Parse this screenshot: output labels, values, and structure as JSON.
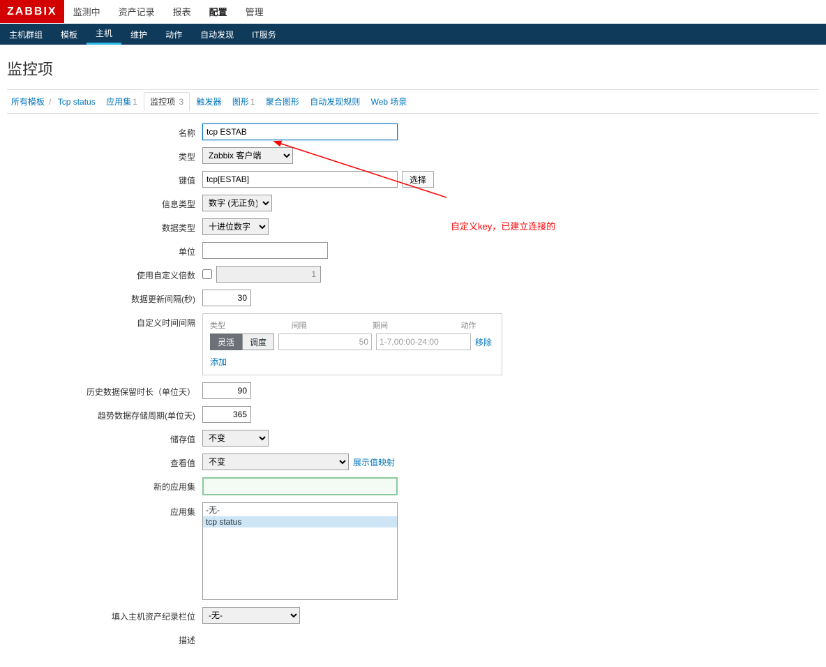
{
  "logo": "ZABBIX",
  "topmenu": {
    "monitoring": "监测中",
    "inventory": "资产记录",
    "reports": "报表",
    "config": "配置",
    "admin": "管理"
  },
  "submenu": {
    "hostgroups": "主机群组",
    "templates": "模板",
    "hosts": "主机",
    "maintenance": "维护",
    "actions": "动作",
    "discovery": "自动发现",
    "itservices": "IT服务"
  },
  "page_title": "监控项",
  "breadcrumb": {
    "all_templates": "所有模板",
    "tcp_status": "Tcp status",
    "apps": "应用集",
    "apps_count": "1",
    "items": "监控项",
    "items_count": "3",
    "triggers": "触发器",
    "graphs": "图形",
    "graphs_count": "1",
    "screens": "聚合图形",
    "drules": "自动发现规则",
    "web": "Web 场景"
  },
  "labels": {
    "name": "名称",
    "type": "类型",
    "key": "键值",
    "info_type": "信息类型",
    "data_type": "数据类型",
    "units": "单位",
    "custom_mult": "使用自定义倍数",
    "update_interval": "数据更新间隔(秒)",
    "custom_intervals": "自定义时间间隔",
    "history": "历史数据保留时长（单位天）",
    "trends": "趋势数据存储周期(单位天)",
    "store": "储存值",
    "show_value": "查看值",
    "new_app": "新的应用集",
    "apps": "应用集",
    "host_inv": "填入主机资产纪录栏位",
    "desc": "描述"
  },
  "values": {
    "name": "tcp ESTAB",
    "type": "Zabbix 客户端",
    "key": "tcp[ESTAB]",
    "info_type": "数字 (无正负)",
    "data_type": "十进位数字",
    "mult_value": "1",
    "update_interval": "30",
    "history": "90",
    "trends": "365",
    "store": "不变",
    "show_value": "不变",
    "host_inv": "-无-"
  },
  "buttons": {
    "select": "选择",
    "flexible": "灵活",
    "scheduling": "调度",
    "remove": "移除",
    "add": "添加",
    "show_map": "展示值映射"
  },
  "interval_hdr": {
    "type": "类型",
    "interval": "间隔",
    "period": "期间",
    "action": "动作"
  },
  "interval_vals": {
    "interval": "50",
    "period": "1-7,00:00-24:00"
  },
  "appset_options": {
    "none": "-无-",
    "tcp": "tcp status"
  },
  "annotation": "自定义key，已建立连接的"
}
